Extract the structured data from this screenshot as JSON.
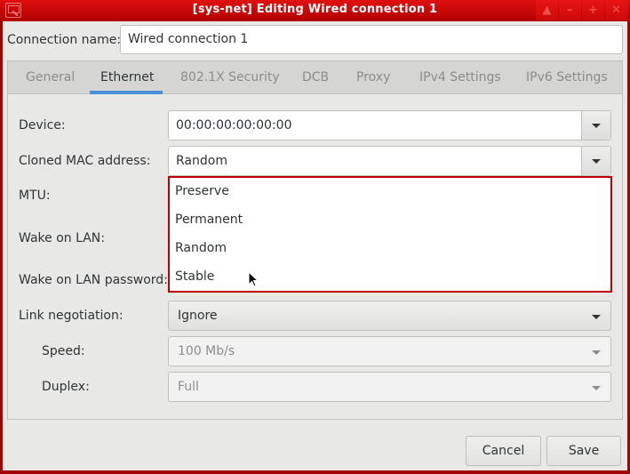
{
  "window": {
    "title": "[sys-net] Editing Wired connection 1",
    "app_icon": "network-settings-icon",
    "controls": [
      {
        "name": "shade-button",
        "icon": "chevron-up-icon",
        "glyph": "▲"
      },
      {
        "name": "minimize-button",
        "icon": "minimize-icon",
        "glyph": "–"
      },
      {
        "name": "maximize-button",
        "icon": "maximize-icon",
        "glyph": "+"
      },
      {
        "name": "close-button",
        "icon": "close-icon",
        "glyph": "✕"
      }
    ]
  },
  "connection_name": {
    "label": "Connection name:",
    "value": "Wired connection 1"
  },
  "tabs": [
    {
      "label": "General",
      "active": false
    },
    {
      "label": "Ethernet",
      "active": true
    },
    {
      "label": "802.1X Security",
      "active": false
    },
    {
      "label": "DCB",
      "active": false
    },
    {
      "label": "Proxy",
      "active": false
    },
    {
      "label": "IPv4 Settings",
      "active": false
    },
    {
      "label": "IPv6 Settings",
      "active": false
    }
  ],
  "ethernet": {
    "device": {
      "label": "Device:",
      "value": "00:00:00:00:00:00"
    },
    "cloned_mac": {
      "label": "Cloned MAC address:",
      "value": "Random",
      "options": [
        "Preserve",
        "Permanent",
        "Random",
        "Stable"
      ]
    },
    "mtu": {
      "label": "MTU:"
    },
    "wake_on_lan": {
      "label": "Wake on LAN:"
    },
    "wake_on_lan_password": {
      "label": "Wake on LAN password:"
    },
    "link_negotiation": {
      "label": "Link negotiation:",
      "value": "Ignore"
    },
    "speed": {
      "label": "Speed:",
      "value": "100 Mb/s",
      "enabled": false
    },
    "duplex": {
      "label": "Duplex:",
      "value": "Full",
      "enabled": false
    }
  },
  "buttons": {
    "cancel": "Cancel",
    "save": "Save"
  },
  "colors": {
    "titlebar": "#cc0000",
    "accent_tab_underline": "#4a90d9",
    "popup_border": "#c00000"
  }
}
